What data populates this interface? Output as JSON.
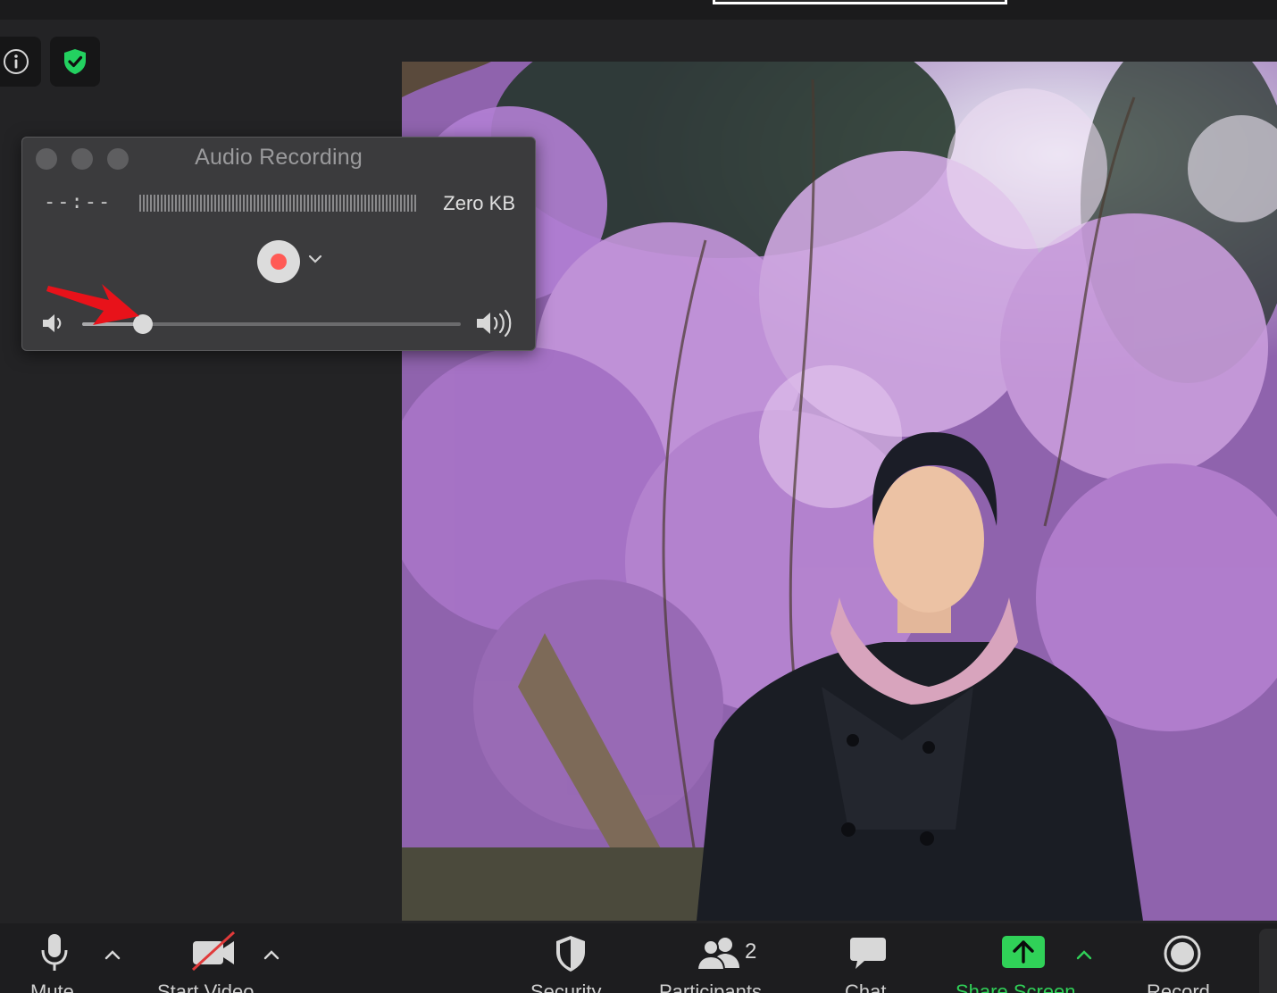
{
  "window": {
    "title": "Audio Recording",
    "time": "--:--",
    "size": "Zero KB",
    "volume_level": 0.16
  },
  "top_controls": {
    "info_icon": "info-icon",
    "security_icon": "shield-check-icon"
  },
  "toolbar": {
    "mute_label": "Mute",
    "start_video_label": "Start Video",
    "security_label": "Security",
    "participants_label": "Participants",
    "participants_count": "2",
    "chat_label": "Chat",
    "share_screen_label": "Share Screen",
    "record_label": "Record"
  },
  "colors": {
    "record_dot": "#ff5a55",
    "share_green": "#30d158",
    "shield_green": "#23d160",
    "annotation_arrow": "#e8121a"
  }
}
